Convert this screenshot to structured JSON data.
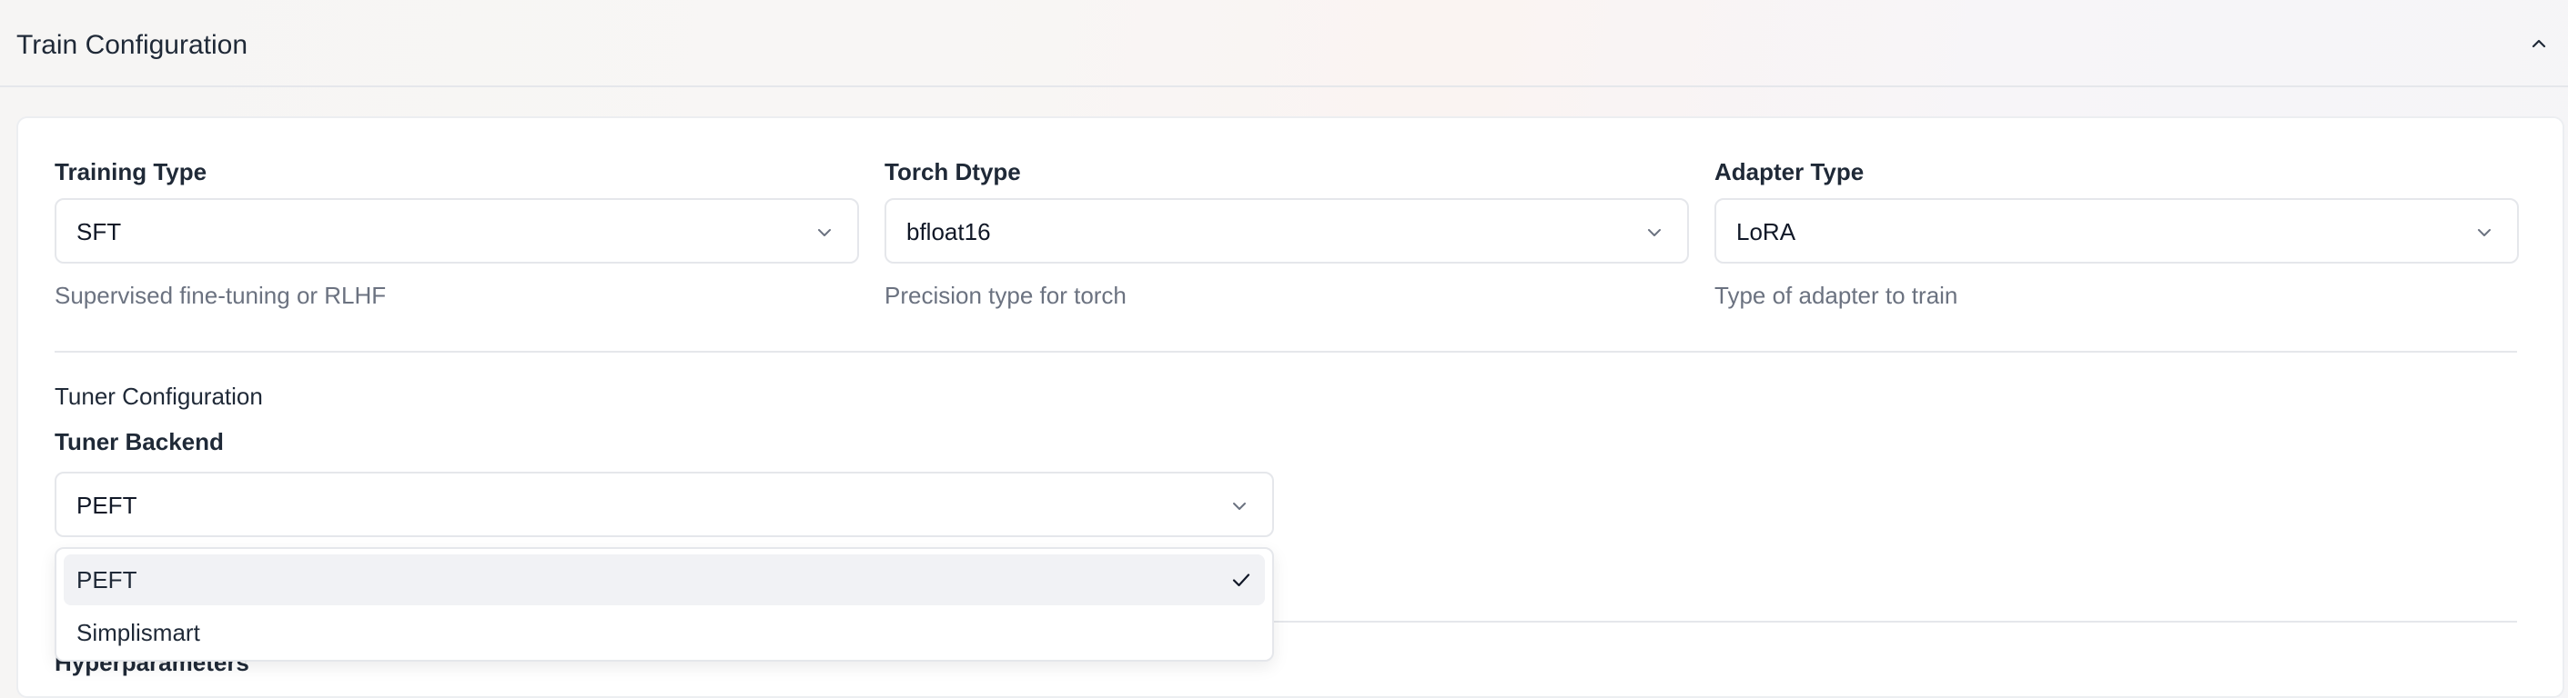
{
  "section": {
    "title": "Train Configuration",
    "collapse_icon": "chevron-up-icon"
  },
  "fields": {
    "training_type": {
      "label": "Training Type",
      "value": "SFT",
      "help": "Supervised fine-tuning or RLHF"
    },
    "torch_dtype": {
      "label": "Torch Dtype",
      "value": "bfloat16",
      "help": "Precision type for torch"
    },
    "adapter_type": {
      "label": "Adapter Type",
      "value": "LoRA",
      "help": "Type of adapter to train"
    }
  },
  "tuner": {
    "heading": "Tuner Configuration",
    "backend_label": "Tuner Backend",
    "backend_value": "PEFT",
    "options": [
      {
        "label": "PEFT",
        "selected": true
      },
      {
        "label": "Simplismart",
        "selected": false
      }
    ]
  },
  "next_section": {
    "heading": "Hyperparameters"
  },
  "colors": {
    "selected_option_bg": "#f1f2f5",
    "help_text": "#6b7280",
    "border": "#e5e7eb"
  }
}
